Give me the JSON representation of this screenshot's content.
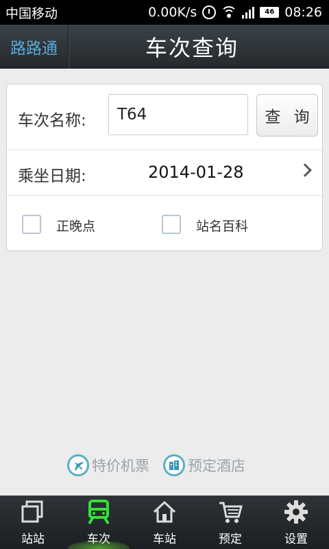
{
  "status_bar": {
    "carrier": "中国移动",
    "speed": "0.00K/s",
    "network": "46",
    "time": "08:26"
  },
  "title_bar": {
    "back_label": "路路通",
    "title": "车次查询"
  },
  "form": {
    "train_label": "车次名称:",
    "train_value": "T64",
    "query_button": "查 询",
    "date_label": "乘坐日期:",
    "date_value": "2014-01-28",
    "check_ontime": "正晚点",
    "check_station_wiki": "站名百科"
  },
  "links": {
    "flight": "特价机票",
    "hotel": "预定酒店"
  },
  "tabs": [
    {
      "label": "站站",
      "icon": "copy-windows-icon"
    },
    {
      "label": "车次",
      "icon": "train-icon"
    },
    {
      "label": "车站",
      "icon": "house-icon"
    },
    {
      "label": "预定",
      "icon": "cart-icon"
    },
    {
      "label": "设置",
      "icon": "gear-icon"
    }
  ],
  "colors": {
    "accent_green": "#35e03a",
    "link_blue": "#5aa9d8"
  }
}
